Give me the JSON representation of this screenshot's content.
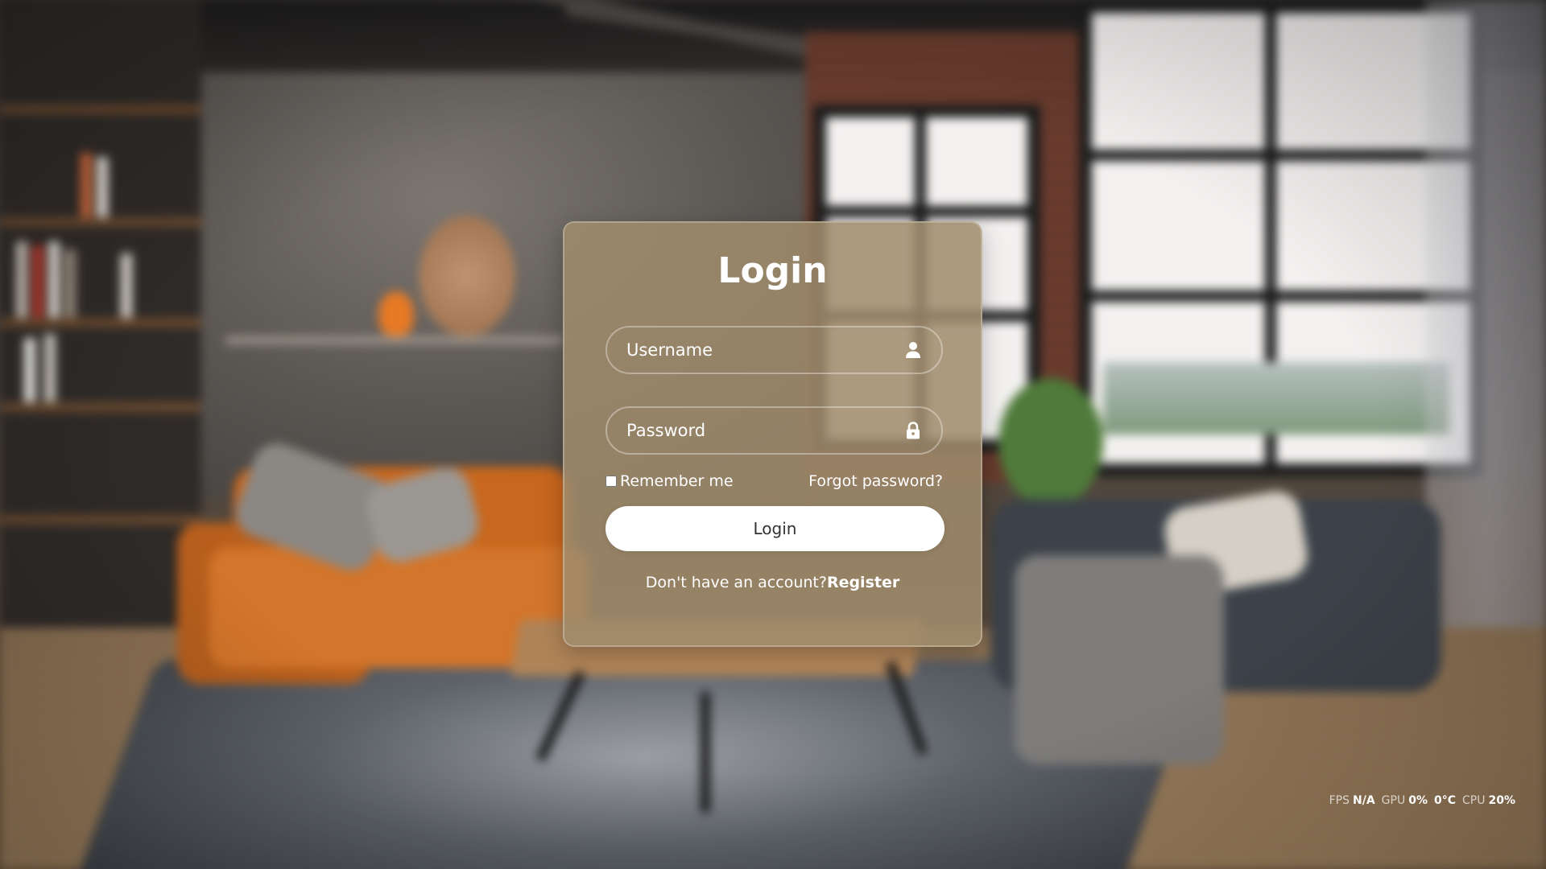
{
  "login": {
    "title": "Login",
    "username_placeholder": "Username",
    "password_placeholder": "Password",
    "remember_label": "Remember me",
    "forgot_label": "Forgot password?",
    "button_label": "Login",
    "no_account_text": "Don't have an account?",
    "register_label": "Register",
    "icons": {
      "username": "user-icon",
      "password": "lock-icon"
    }
  },
  "perf": {
    "fps_label": "FPS",
    "fps_value": "N/A",
    "gpu_label": "GPU",
    "gpu_value": "0%",
    "temp_value": "0°C",
    "cpu_label": "CPU",
    "cpu_value": "20%"
  }
}
